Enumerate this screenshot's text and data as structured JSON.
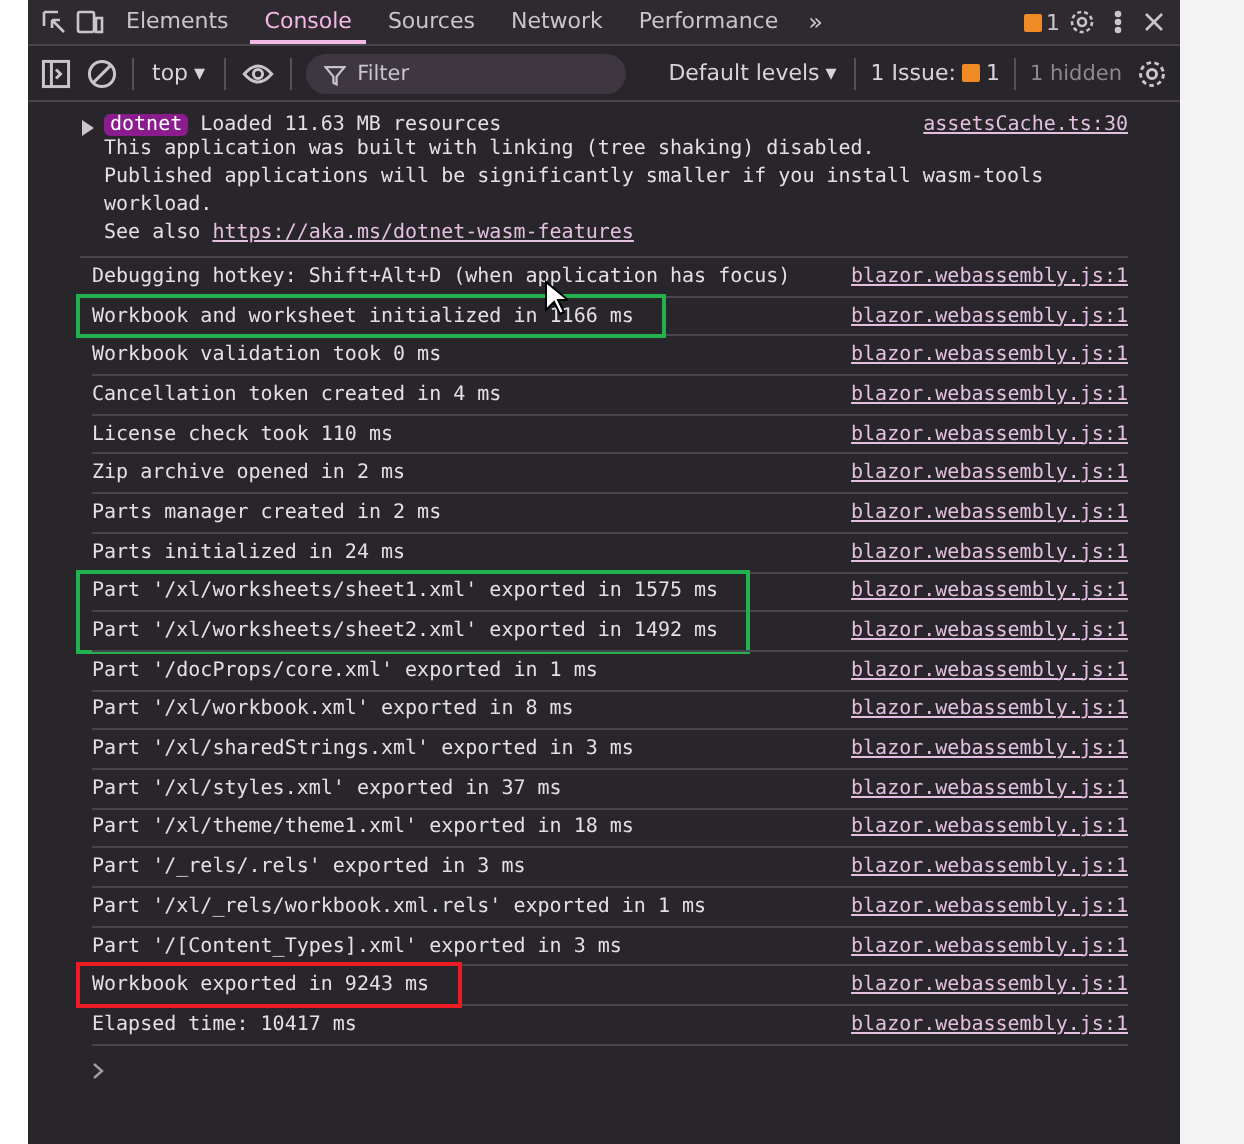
{
  "tabs": [
    {
      "label": "Elements",
      "selected": false
    },
    {
      "label": "Console",
      "selected": true
    },
    {
      "label": "Sources",
      "selected": false
    },
    {
      "label": "Network",
      "selected": false
    },
    {
      "label": "Performance",
      "selected": false
    }
  ],
  "tab_bar": {
    "more": "»",
    "issues_count": "1"
  },
  "toolbar": {
    "caret": "▾",
    "context": "top",
    "filter": {
      "placeholder": "Filter"
    },
    "levels": "Default levels",
    "issues_label": "1 Issue:",
    "issues_count": "1",
    "hidden": "1 hidden"
  },
  "group": {
    "expanded": false,
    "badge": "dotnet",
    "title": "Loaded 11.63 MB resources",
    "source": "assetsCache.ts:30",
    "lines": [
      "This application was built with linking (tree shaking) disabled.",
      "Published applications will be significantly smaller if you install wasm-tools workload."
    ],
    "see_also": "See also",
    "link": "https://aka.ms/dotnet-wasm-features"
  },
  "messages": [
    {
      "text": "Debugging hotkey: Shift+Alt+D (when application has focus)",
      "source": "blazor.webassembly.js:1"
    },
    {
      "text": "Workbook and worksheet initialized in 1166 ms",
      "source": "blazor.webassembly.js:1",
      "color": "#22b14c"
    },
    {
      "text": "Workbook validation took 0 ms",
      "source": "blazor.webassembly.js:1"
    },
    {
      "text": "Cancellation token created in 4 ms",
      "source": "blazor.webassembly.js:1"
    },
    {
      "text": "License check took 110 ms",
      "source": "blazor.webassembly.js:1"
    },
    {
      "text": "Zip archive opened in 2 ms",
      "source": "blazor.webassembly.js:1"
    },
    {
      "text": "Parts manager created in 2 ms",
      "source": "blazor.webassembly.js:1"
    },
    {
      "text": "Parts initialized in 24 ms",
      "source": "blazor.webassembly.js:1"
    },
    {
      "text": "Part '/xl/worksheets/sheet1.xml' exported in 1575 ms",
      "source": "blazor.webassembly.js:1",
      "color": "#22b14c"
    },
    {
      "text": "Part '/xl/worksheets/sheet2.xml' exported in 1492 ms",
      "source": "blazor.webassembly.js:1",
      "color": "#22b14c"
    },
    {
      "text": "Part '/docProps/core.xml' exported in 1 ms",
      "source": "blazor.webassembly.js:1"
    },
    {
      "text": "Part '/xl/workbook.xml' exported in 8 ms",
      "source": "blazor.webassembly.js:1"
    },
    {
      "text": "Part '/xl/sharedStrings.xml' exported in 3 ms",
      "source": "blazor.webassembly.js:1"
    },
    {
      "text": "Part '/xl/styles.xml' exported in 37 ms",
      "source": "blazor.webassembly.js:1"
    },
    {
      "text": "Part '/xl/theme/theme1.xml' exported in 18 ms",
      "source": "blazor.webassembly.js:1"
    },
    {
      "text": "Part '/_rels/.rels' exported in 3 ms",
      "source": "blazor.webassembly.js:1"
    },
    {
      "text": "Part '/xl/_rels/workbook.xml.rels' exported in 1 ms",
      "source": "blazor.webassembly.js:1"
    },
    {
      "text": "Part '/[Content_Types].xml' exported in 3 ms",
      "source": "blazor.webassembly.js:1"
    },
    {
      "text": "Workbook exported in 9243 ms",
      "source": "blazor.webassembly.js:1",
      "color": "#ed1c24"
    },
    {
      "text": "Elapsed time: 10417 ms",
      "source": "blazor.webassembly.js:1"
    }
  ]
}
